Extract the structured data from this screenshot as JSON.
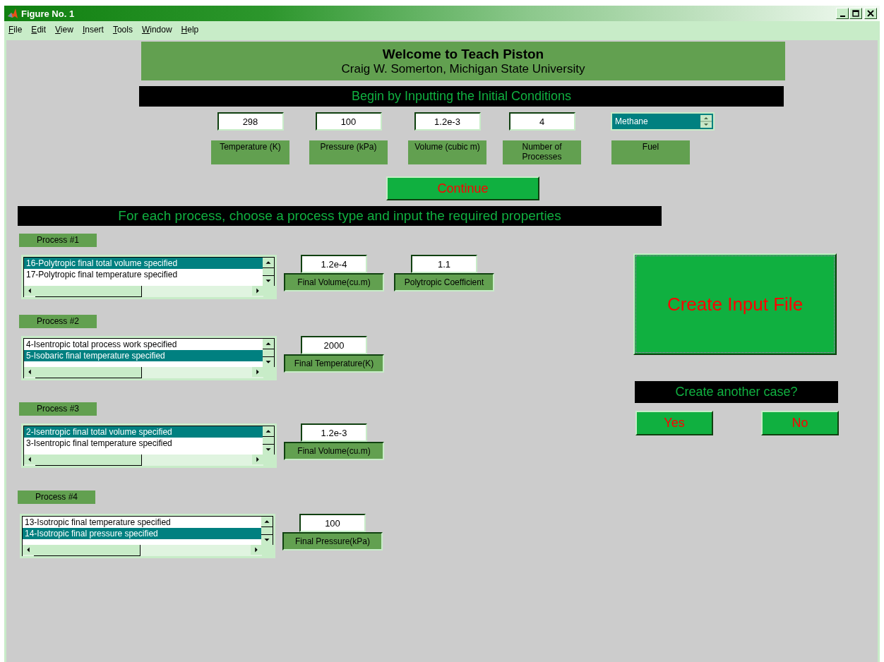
{
  "window": {
    "title": "Figure No. 1"
  },
  "menu": [
    "File",
    "Edit",
    "View",
    "Insert",
    "Tools",
    "Window",
    "Help"
  ],
  "header": {
    "title": "Welcome to Teach Piston",
    "subtitle": "Craig W. Somerton, Michigan State University"
  },
  "initial_banner": "Begin by Inputting the Initial Conditions",
  "initial_conditions": [
    {
      "value": "298",
      "label": "Temperature (K)"
    },
    {
      "value": "100",
      "label": "Pressure (kPa)"
    },
    {
      "value": "1.2e-3",
      "label": "Volume (cubic m)"
    },
    {
      "value": "4",
      "label": "Number of Processes"
    }
  ],
  "fuel": {
    "value": "Methane",
    "label": "Fuel"
  },
  "continue_button": "Continue",
  "process_banner": "For each process, choose a process type and input the required properties",
  "processes": [
    {
      "label": "Process #1",
      "options": [
        {
          "text": "16-Polytropic final total volume specified",
          "selected": true
        },
        {
          "text": "17-Polytropic final temperature specified",
          "selected": false
        }
      ],
      "inputs": [
        {
          "value": "1.2e-4",
          "label": "Final Volume(cu.m)"
        },
        {
          "value": "1.1",
          "label": "Polytropic Coefficient"
        }
      ]
    },
    {
      "label": "Process #2",
      "options": [
        {
          "text": "4-Isentropic total process work specified",
          "selected": false
        },
        {
          "text": "5-Isobaric final temperature specified",
          "selected": true
        }
      ],
      "inputs": [
        {
          "value": "2000",
          "label": "Final Temperature(K)"
        }
      ]
    },
    {
      "label": "Process #3",
      "options": [
        {
          "text": "2-Isentropic final total volume specified",
          "selected": true
        },
        {
          "text": "3-Isentropic final temperature specified",
          "selected": false
        }
      ],
      "inputs": [
        {
          "value": "1.2e-3",
          "label": "Final Volume(cu.m)"
        }
      ]
    },
    {
      "label": "Process #4",
      "options": [
        {
          "text": "13-Isotropic final temperature specified",
          "selected": false
        },
        {
          "text": "14-Isotropic final pressure specified",
          "selected": true
        }
      ],
      "inputs": [
        {
          "value": "100",
          "label": "Final Pressure(kPa)"
        }
      ]
    }
  ],
  "create_button": "Create Input File",
  "another_case": {
    "prompt": "Create another case?",
    "buttons": [
      "Yes",
      "No"
    ]
  }
}
